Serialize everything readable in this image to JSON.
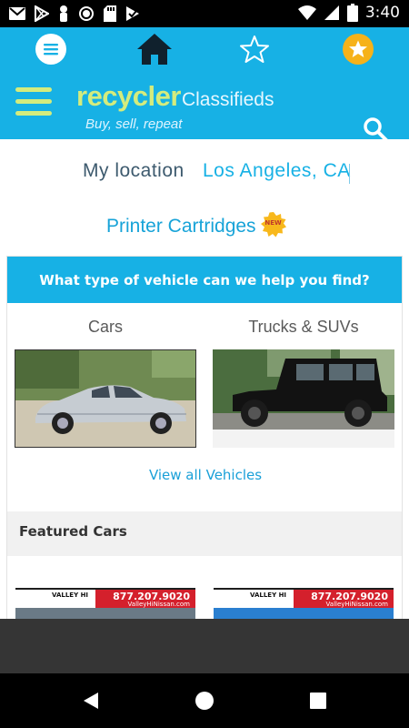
{
  "status_bar": {
    "time": "3:40",
    "icons": [
      "gmail-icon",
      "play-store-icon",
      "notification-icon",
      "circle-icon",
      "sd-card-icon",
      "checkmark-icon",
      "wifi-icon",
      "signal-icon",
      "battery-icon"
    ]
  },
  "header": {
    "top_icons": [
      "menu-circle-icon",
      "home-icon",
      "star-outline-icon",
      "star-gold-icon"
    ],
    "logo_main": "recycler",
    "logo_sub": "Classifieds",
    "tagline": "Buy, sell, repeat"
  },
  "location": {
    "label": "My location",
    "value": "Los Angeles, CA"
  },
  "promo": {
    "label": "Printer Cartridges",
    "badge": "NEW"
  },
  "vehicles": {
    "title": "What type of vehicle can we help you find?",
    "categories": [
      {
        "label": "Cars"
      },
      {
        "label": "Trucks & SUVs"
      }
    ],
    "view_all": "View all Vehicles"
  },
  "featured": {
    "title": "Featured Cars",
    "ads": [
      {
        "dealer": "VALLEY HI",
        "phone": "877.207.9020",
        "site": "ValleyHiNissan.com"
      },
      {
        "dealer": "VALLEY HI",
        "phone": "877.207.9020",
        "site": "ValleyHiNissan.com"
      }
    ]
  },
  "colors": {
    "header_blue": "#17b1e5",
    "logo_green": "#d4ec7d",
    "gold": "#f6b21a",
    "link_blue": "#1aa0d8"
  }
}
